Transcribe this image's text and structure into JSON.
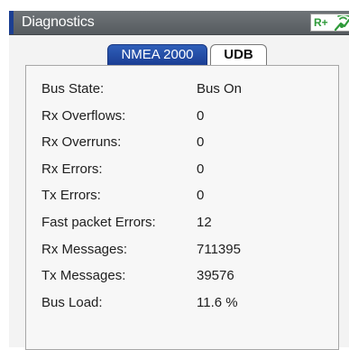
{
  "window": {
    "title": "Diagnostics",
    "status": {
      "rplus_label": "R+",
      "antenna_icon": "antenna-icon",
      "accent_color": "#2f9a3a"
    }
  },
  "tabs": [
    {
      "label": "NMEA 2000",
      "active": true
    },
    {
      "label": "UDB",
      "active": false
    }
  ],
  "diagnostics": [
    {
      "label": "Bus State:",
      "value": "Bus On"
    },
    {
      "label": "Rx Overflows:",
      "value": "0"
    },
    {
      "label": "Rx Overruns:",
      "value": "0"
    },
    {
      "label": "Rx Errors:",
      "value": "0"
    },
    {
      "label": "Tx Errors:",
      "value": "0"
    },
    {
      "label": "Fast packet Errors:",
      "value": "12"
    },
    {
      "label": "Rx Messages:",
      "value": "711395"
    },
    {
      "label": "Tx Messages:",
      "value": "39576"
    },
    {
      "label": "Bus Load:",
      "value": "11.6 %"
    }
  ],
  "colors": {
    "active_tab": "#1b3e94",
    "titlebar": "#5f6468"
  }
}
